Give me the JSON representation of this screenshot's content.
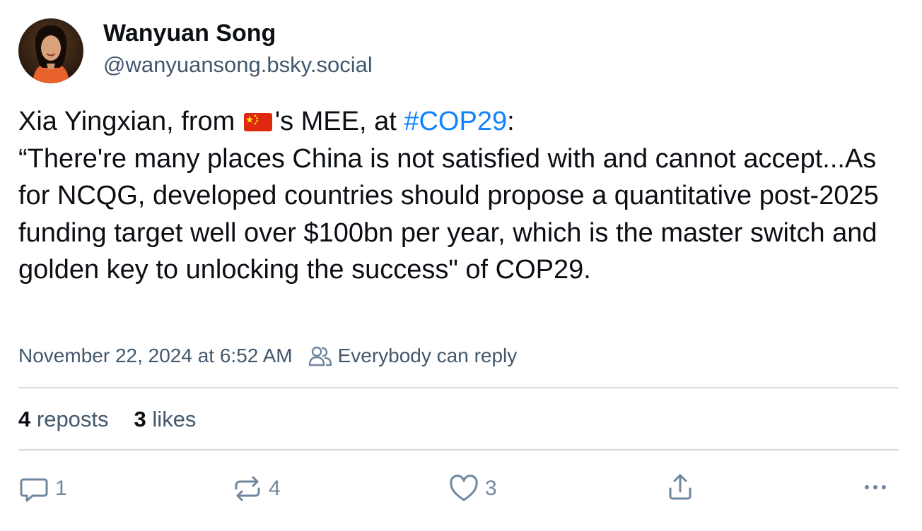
{
  "author": {
    "display_name": "Wanyuan Song",
    "handle": "@wanyuansong.bsky.social"
  },
  "post": {
    "text_before_flag": "Xia Yingxian, from ",
    "flag_emoji": "🇨🇳",
    "text_after_flag": "'s MEE, at ",
    "hashtag": "#COP29",
    "text_after_hashtag": ":",
    "quote": "“There're many places China is not satisfied with and cannot accept...As for NCQG, developed countries should propose a quantitative post-2025 funding target well over $100bn per year, which is the master switch and golden key to unlocking the success\" of COP29."
  },
  "meta": {
    "timestamp": "November 22, 2024 at 6:52 AM",
    "reply_setting": "Everybody can reply"
  },
  "stats": {
    "reposts_count": "4",
    "reposts_label": "reposts",
    "likes_count": "3",
    "likes_label": "likes"
  },
  "actions": {
    "reply_count": "1",
    "repost_count": "4",
    "like_count": "3"
  },
  "colors": {
    "text": "#0b0f14",
    "secondary": "#42576c",
    "hashtag": "#1083fe",
    "action_icon": "#6f869f",
    "divider": "#d4dbe2"
  }
}
